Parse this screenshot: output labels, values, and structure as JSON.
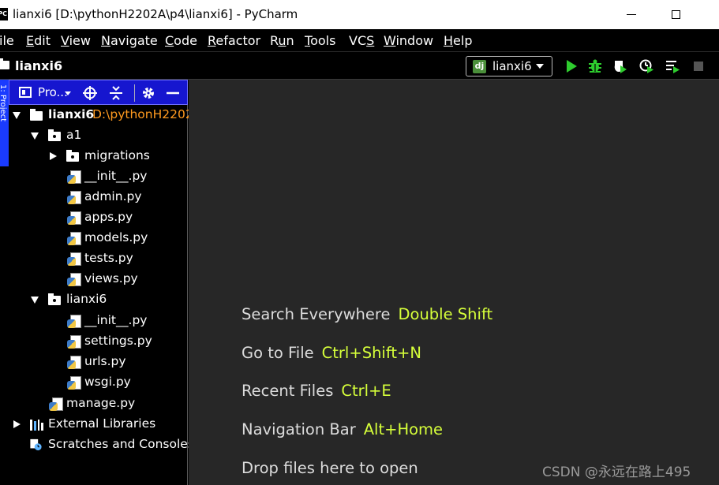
{
  "window": {
    "app_icon_text": "PC",
    "title": "lianxi6 [D:\\pythonH2202A\\p4\\lianxi6] - PyCharm"
  },
  "menubar": {
    "items": [
      {
        "pre": "",
        "u": "F",
        "post": "ile",
        "shown": "ile"
      },
      {
        "pre": "",
        "u": "E",
        "post": "dit"
      },
      {
        "pre": "",
        "u": "V",
        "post": "iew"
      },
      {
        "pre": "",
        "u": "N",
        "post": "avigate"
      },
      {
        "pre": "",
        "u": "C",
        "post": "ode"
      },
      {
        "pre": "",
        "u": "R",
        "post": "efactor"
      },
      {
        "pre": "R",
        "u": "u",
        "post": "n"
      },
      {
        "pre": "",
        "u": "T",
        "post": "ools"
      },
      {
        "pre": "VC",
        "u": "S",
        "post": ""
      },
      {
        "pre": "",
        "u": "W",
        "post": "indow"
      },
      {
        "pre": "",
        "u": "H",
        "post": "elp"
      }
    ]
  },
  "navbar": {
    "project": "lianxi6",
    "run_config": {
      "badge": "dj",
      "label": "lianxi6"
    }
  },
  "toolbar_icons": [
    "run-icon",
    "debug-icon",
    "coverage-icon",
    "profile-icon",
    "concurrency-icon",
    "stop-icon"
  ],
  "colors": {
    "run": "#2ecc2e",
    "debug": "#2ecc2e",
    "panel_header": "#1616cf",
    "path": "#ff9a1f",
    "shortcut": "#d6ff3a",
    "editor_bg": "#272727"
  },
  "left_stripe": {
    "tab_label": "1: Project"
  },
  "project_panel": {
    "view_label": "Pro..."
  },
  "tree": {
    "root": {
      "name": "lianxi6",
      "path": "D:\\pythonH2202"
    },
    "a1": "a1",
    "migrations": "migrations",
    "a1_files": [
      "__init__.py",
      "admin.py",
      "apps.py",
      "models.py",
      "tests.py",
      "views.py"
    ],
    "pkg": "lianxi6",
    "pkg_files": [
      "__init__.py",
      "settings.py",
      "urls.py",
      "wsgi.py"
    ],
    "manage": "manage.py",
    "external": "External Libraries",
    "scratches": "Scratches and Consoles"
  },
  "welcome": {
    "hints": [
      {
        "text": "Search Everywhere",
        "key": "Double Shift"
      },
      {
        "text": "Go to File",
        "key": "Ctrl+Shift+N"
      },
      {
        "text": "Recent Files",
        "key": "Ctrl+E"
      },
      {
        "text": "Navigation Bar",
        "key": "Alt+Home"
      },
      {
        "text": "Drop files here to open",
        "key": ""
      }
    ]
  },
  "watermark": "CSDN @永远在路上495"
}
